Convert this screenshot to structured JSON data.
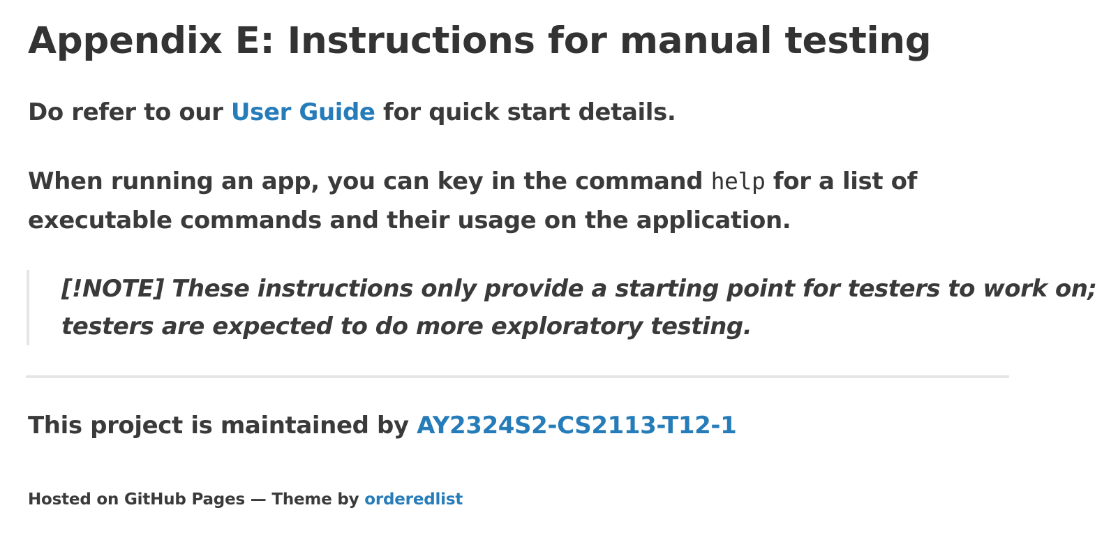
{
  "title": "Appendix E: Instructions for manual testing",
  "intro": {
    "before_link": "Do refer to our ",
    "link_text": "User Guide",
    "after_link": " for quick start details."
  },
  "usage": {
    "line1_before_code": "When running an app, you can key in the command ",
    "code": "help",
    "line1_after_code": " for a list of",
    "line2": "executable commands and their usage on the application."
  },
  "note": {
    "line1": "[!NOTE] These instructions only provide a starting point for testers to work on;",
    "line2": "testers are expected to do more exploratory testing."
  },
  "footer": {
    "maintained_prefix": "This project is maintained by ",
    "maintainer_link": "AY2324S2-CS2113-T12-1",
    "hosted_prefix": "Hosted on GitHub Pages — Theme by ",
    "theme_link": "orderedlist"
  },
  "colors": {
    "text": "#3a3a3a",
    "link": "#267cb9",
    "rule": "#e5e5e5"
  }
}
